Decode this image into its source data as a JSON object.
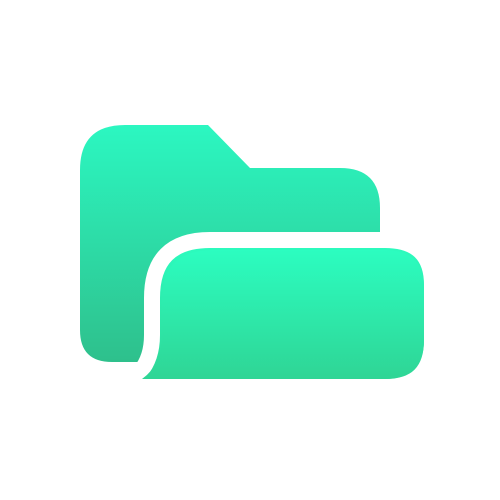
{
  "icon": {
    "name": "folder-open-icon",
    "colors": {
      "back_top": "#2cf7c1",
      "back_bottom": "#2ec08c",
      "front_top": "#2cfdc0",
      "front_bottom": "#2fd595",
      "outline": "#ffffff",
      "background": "#ffffff"
    }
  }
}
